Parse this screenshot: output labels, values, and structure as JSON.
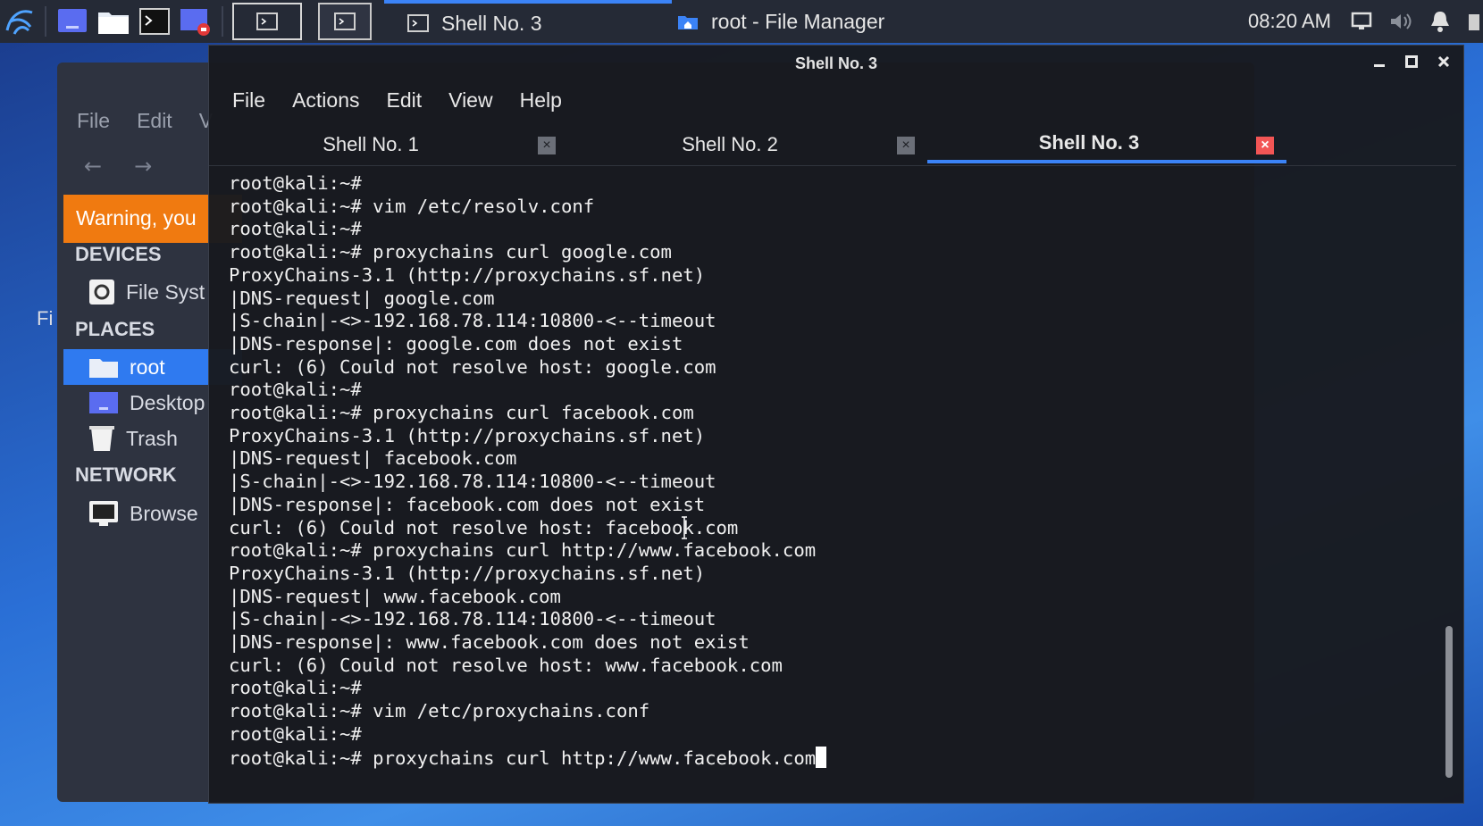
{
  "taskbar": {
    "tasks": [
      {
        "label": "Shell No. 3",
        "icon": "terminal-icon",
        "active": true
      },
      {
        "label": "root - File Manager",
        "icon": "folder-home-icon",
        "active": false
      }
    ],
    "clock": "08:20 AM",
    "icons": [
      "kali-menu-icon",
      "workspace-icon",
      "file-manager-icon",
      "terminal-icon",
      "screen-recorder-icon",
      "display-icon",
      "volume-icon",
      "notification-bell-icon"
    ]
  },
  "file_manager": {
    "menu": [
      "File",
      "Edit",
      "V"
    ],
    "warning": "Warning, you",
    "sections": {
      "devices": "DEVICES",
      "places": "PLACES",
      "network": "NETWORK"
    },
    "devices": [
      {
        "label": "File Syst",
        "icon": "drive-icon"
      }
    ],
    "places": [
      {
        "label": "root",
        "icon": "folder-home-icon",
        "selected": true
      },
      {
        "label": "Desktop",
        "icon": "desktop-folder-icon",
        "selected": false
      },
      {
        "label": "Trash",
        "icon": "trash-icon",
        "selected": false
      }
    ],
    "network": [
      {
        "label": "Browse",
        "icon": "network-icon"
      }
    ],
    "fragment": "Fi"
  },
  "terminal": {
    "title": "Shell No. 3",
    "menu": [
      "File",
      "Actions",
      "Edit",
      "View",
      "Help"
    ],
    "tabs": [
      {
        "label": "Shell No. 1",
        "active": false
      },
      {
        "label": "Shell No. 2",
        "active": false
      },
      {
        "label": "Shell No. 3",
        "active": true
      }
    ],
    "lines": [
      "root@kali:~#",
      "root@kali:~# vim /etc/resolv.conf",
      "root@kali:~#",
      "root@kali:~# proxychains curl google.com",
      "ProxyChains-3.1 (http://proxychains.sf.net)",
      "|DNS-request| google.com",
      "|S-chain|-<>-192.168.78.114:10800-<--timeout",
      "|DNS-response|: google.com does not exist",
      "curl: (6) Could not resolve host: google.com",
      "root@kali:~#",
      "root@kali:~# proxychains curl facebook.com",
      "ProxyChains-3.1 (http://proxychains.sf.net)",
      "|DNS-request| facebook.com",
      "|S-chain|-<>-192.168.78.114:10800-<--timeout",
      "|DNS-response|: facebook.com does not exist",
      "curl: (6) Could not resolve host: facebook.com",
      "root@kali:~# proxychains curl http://www.facebook.com",
      "ProxyChains-3.1 (http://proxychains.sf.net)",
      "|DNS-request| www.facebook.com",
      "|S-chain|-<>-192.168.78.114:10800-<--timeout",
      "|DNS-response|: www.facebook.com does not exist",
      "curl: (6) Could not resolve host: www.facebook.com",
      "root@kali:~#",
      "root@kali:~# vim /etc/proxychains.conf",
      "root@kali:~#",
      "root@kali:~# proxychains curl http://www.facebook.com"
    ]
  },
  "colors": {
    "accent": "#3b83f7",
    "warning": "#f07a10",
    "close_active": "#f25555"
  }
}
